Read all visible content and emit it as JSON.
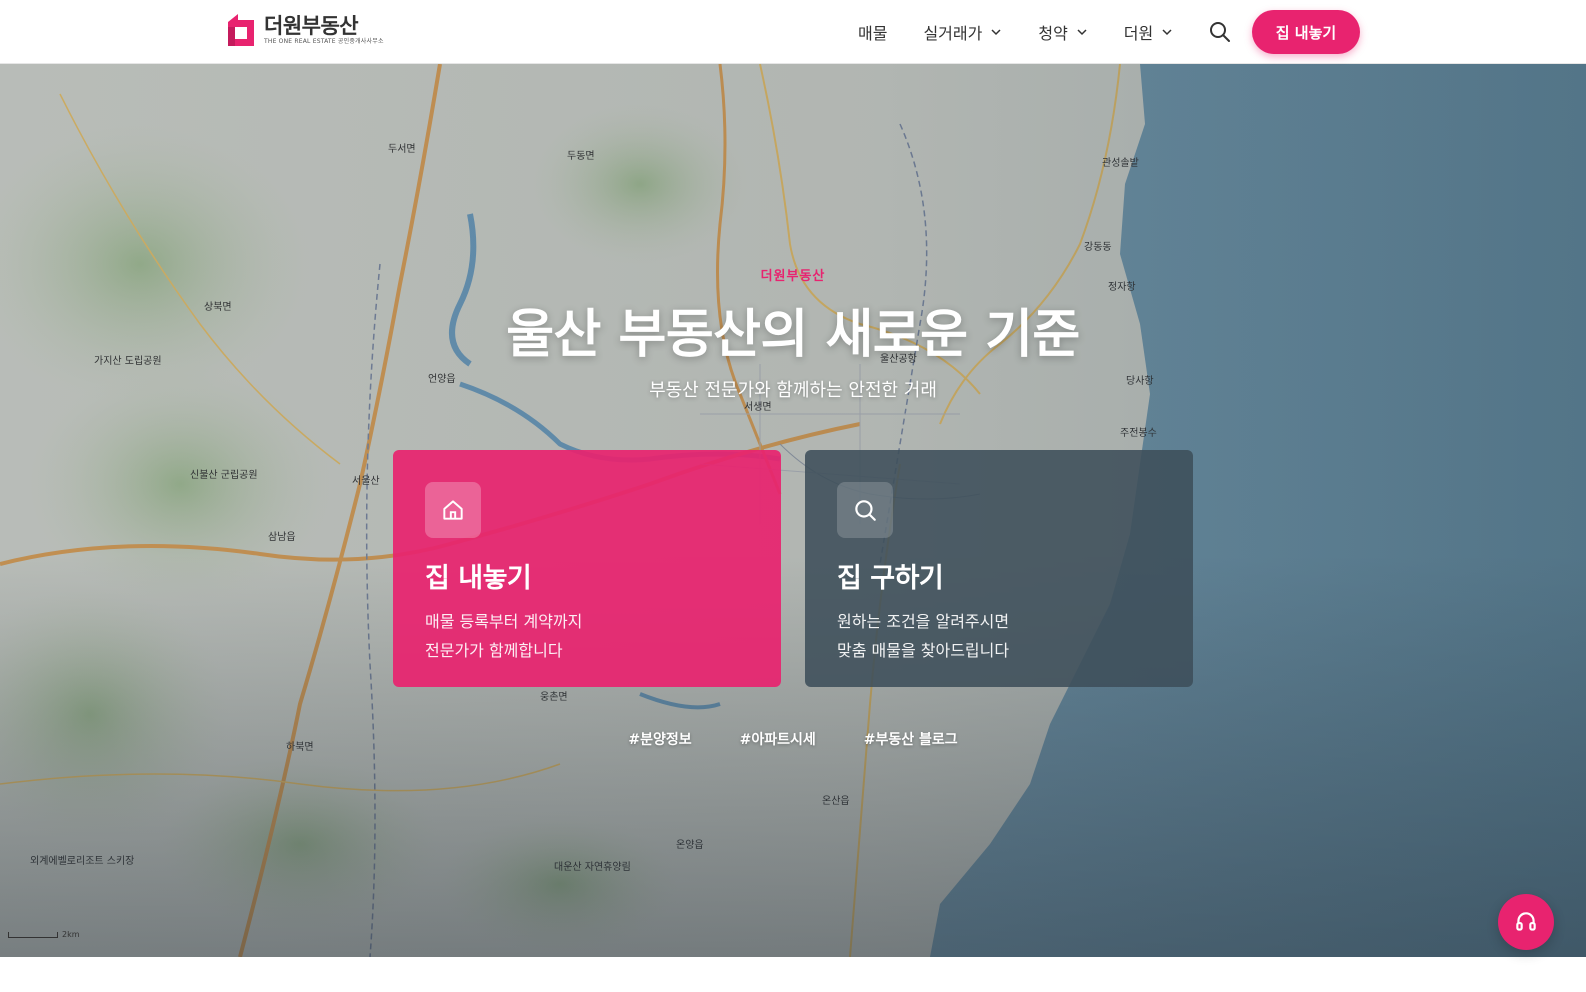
{
  "brand": {
    "name": "더원부동산",
    "sub": "THE ONE REAL ESTATE  공인중개사사무소",
    "accent": "#e8236f"
  },
  "nav": {
    "items": [
      {
        "label": "매물",
        "has_dropdown": false
      },
      {
        "label": "실거래가",
        "has_dropdown": true
      },
      {
        "label": "청약",
        "has_dropdown": true
      },
      {
        "label": "더원",
        "has_dropdown": true
      }
    ],
    "search_icon": "search-icon",
    "cta_label": "집 내놓기"
  },
  "hero": {
    "eyebrow": "더원부동산",
    "headline": "울산 부동산의 새로운 기준",
    "subline": "부동산 전문가와 함께하는 안전한 거래",
    "cards": [
      {
        "icon": "home-icon",
        "title": "집 내놓기",
        "desc_line1": "매물 등록부터 계약까지",
        "desc_line2": "전문가가 함께합니다"
      },
      {
        "icon": "search-icon",
        "title": "집 구하기",
        "desc_line1": "원하는 조건을 알려주시면",
        "desc_line2": "맞춤 매물을 찾아드립니다"
      }
    ],
    "tags": [
      "#분양정보",
      "#아파트시세",
      "#부동산 블로그"
    ],
    "map_scale": "2km",
    "map_labels": [
      "두서면",
      "두동면",
      "상북면",
      "언양읍",
      "삼남읍",
      "웅촌면",
      "하북면",
      "온산읍",
      "온양읍",
      "서울산",
      "신불산 군립공원",
      "가지산 도립공원",
      "대운산 자연휴양림",
      "정자항",
      "당사항",
      "주전봉수",
      "강동동",
      "관성솔밭",
      "울산공항",
      "서생면",
      "외계에벨로리조트 스키장"
    ]
  },
  "fab": {
    "icon": "headset-icon"
  }
}
